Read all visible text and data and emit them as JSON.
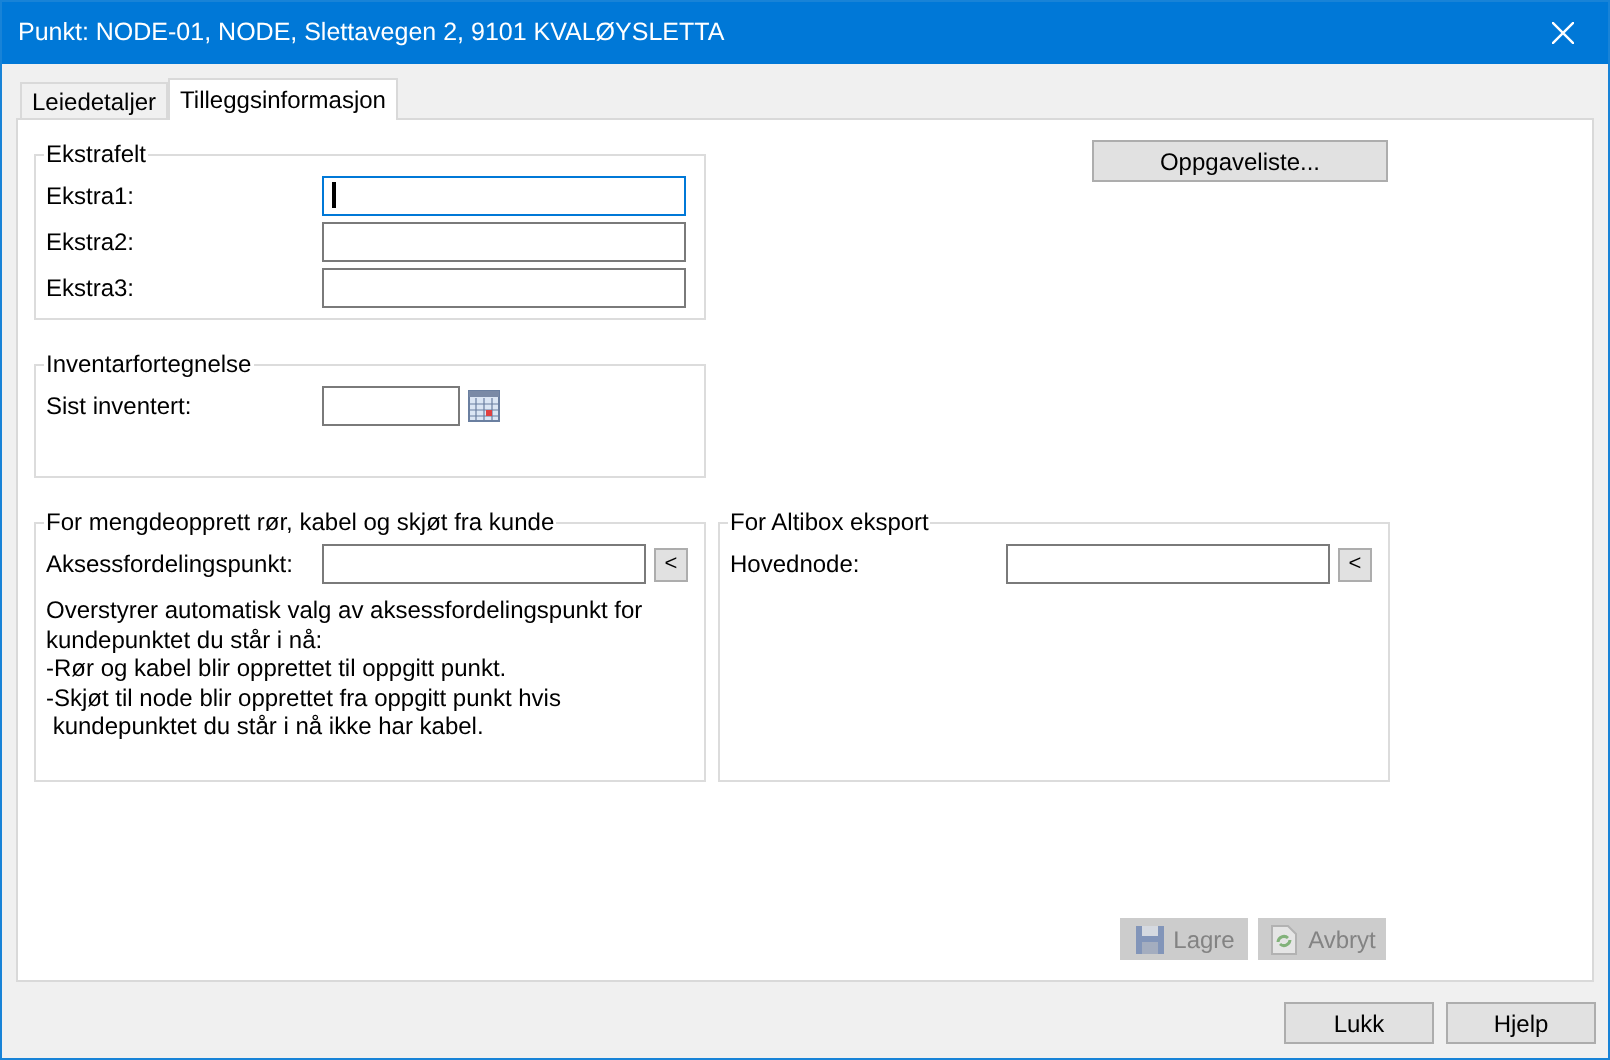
{
  "window": {
    "title": "Punkt: NODE-01, NODE, Slettavegen 2, 9101 KVALØYSLETTA"
  },
  "tabs": [
    {
      "label": "Leiedetaljer",
      "selected": false
    },
    {
      "label": "Tilleggsinformasjon",
      "selected": true
    }
  ],
  "extra_fields": {
    "legend": "Ekstrafelt",
    "rows": [
      {
        "label": "Ekstra1:",
        "focused": true
      },
      {
        "label": "Ekstra2:",
        "focused": false
      },
      {
        "label": "Ekstra3:",
        "focused": false
      }
    ]
  },
  "task_list_button": "Oppgaveliste...",
  "inventory": {
    "legend": "Inventarfortegnelse",
    "label": "Sist inventert:"
  },
  "customer_creation": {
    "legend": "For mengdeopprett rør, kabel og skjøt fra kunde",
    "label": "Aksessfordelingspunkt:",
    "pick_button": "<",
    "description": [
      "Overstyrer automatisk valg av aksessfordelingspunkt for",
      "kundepunktet du står i nå:",
      "-Rør og kabel blir opprettet til oppgitt punkt.",
      "-Skjøt til node blir opprettet fra oppgitt punkt hvis",
      " kundepunktet du står i nå ikke har kabel."
    ]
  },
  "altibox": {
    "legend": "For Altibox eksport",
    "label": "Hovednode:",
    "pick_button": "<"
  },
  "panel_buttons": [
    {
      "kind": "save",
      "label": "Lagre",
      "disabled": true
    },
    {
      "kind": "cancel",
      "label": "Avbryt",
      "disabled": true
    }
  ],
  "dialog_buttons": [
    "Lukk",
    "Hjelp"
  ]
}
